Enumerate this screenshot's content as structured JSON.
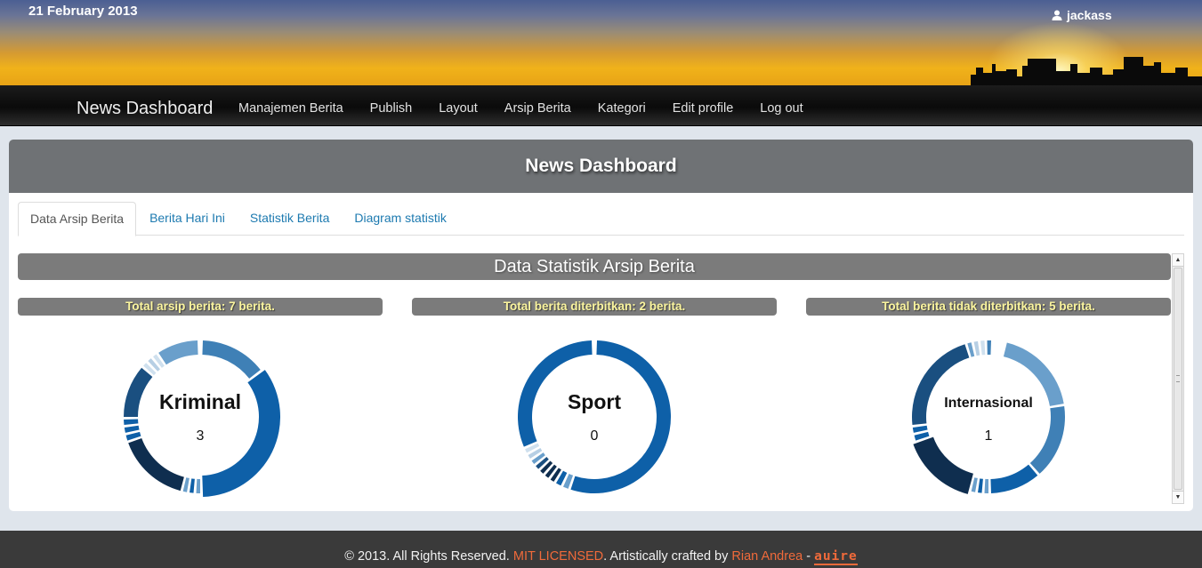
{
  "header": {
    "date": "21 February 2013",
    "username": "jackass"
  },
  "navbar": {
    "brand": "News Dashboard",
    "items": [
      {
        "label": "Manajemen Berita"
      },
      {
        "label": "Publish"
      },
      {
        "label": "Layout"
      },
      {
        "label": "Arsip Berita"
      },
      {
        "label": "Kategori"
      },
      {
        "label": "Edit profile"
      },
      {
        "label": "Log out"
      }
    ]
  },
  "hero": {
    "title": "News Dashboard"
  },
  "tabs": [
    {
      "label": "Data Arsip Berita",
      "active": true
    },
    {
      "label": "Berita Hari Ini",
      "active": false
    },
    {
      "label": "Statistik Berita",
      "active": false
    },
    {
      "label": "Diagram statistik",
      "active": false
    }
  ],
  "section": {
    "title": "Data Statistik Arsip Berita",
    "stats": [
      {
        "text": "Total arsip berita: 7 berita.",
        "donut_label": "Kriminal",
        "donut_count": "3"
      },
      {
        "text": "Total berita diterbitkan: 2 berita.",
        "donut_label": "Sport",
        "donut_count": "0"
      },
      {
        "text": "Total berita tidak diterbitkan: 5 berita.",
        "donut_label": "Internasional",
        "donut_count": "1"
      }
    ]
  },
  "footer": {
    "copyright": "© 2013. All Rights Reserved. ",
    "license": "MIT LICENSED",
    "crafted": ". Artistically crafted by ",
    "author": "Rian Andrea",
    "sep": " - ",
    "logo": "auire"
  },
  "colors": {
    "accent_link": "#1d7ab0",
    "stat_text": "#fbf59e",
    "footer_link": "#f06a3a",
    "donut_dark": "#0f2e4f",
    "donut_mid": "#0e60a8",
    "donut_light": "#6a9fcb"
  },
  "icons": {
    "user": "user-icon"
  }
}
